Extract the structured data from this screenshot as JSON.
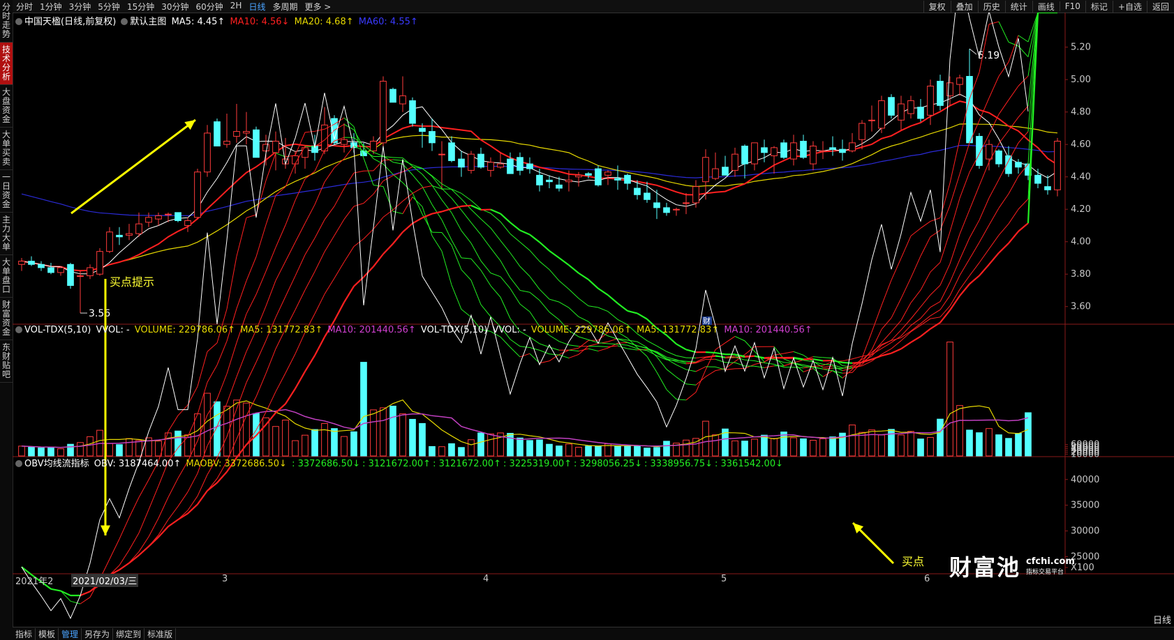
{
  "left_rail": [
    "分时走势",
    "技术分析",
    "大盘资金",
    "大单买卖",
    "一日资金",
    "主力大单",
    "大单盘口",
    "财富资金",
    "东财贴吧"
  ],
  "left_rail_active": 1,
  "topbar": {
    "periods": [
      "分时",
      "1分钟",
      "3分钟",
      "5分钟",
      "15分钟",
      "30分钟",
      "60分钟",
      "2H",
      "日线",
      "多周期",
      "更多 >"
    ],
    "active_period": 8,
    "tools": [
      "复权",
      "叠加",
      "历史",
      "统计",
      "画线",
      "F10",
      "标记",
      "+自选",
      "返回"
    ]
  },
  "main_legend": {
    "title": "中国天楹(日线,前复权)",
    "indicator": "默认主图",
    "ma5": "MA5: 4.45↑",
    "ma10": "MA10: 4.56↓",
    "ma20": "MA20: 4.68↑",
    "ma60": "MA60: 4.55↑"
  },
  "vol_legend": {
    "name": "VOL-TDX(5,10)",
    "vvol": "VVOL: -",
    "volume": "VOLUME: 229786.06↑",
    "ma5": "MA5: 131772.83↑",
    "ma10": "MA10: 201440.56↑",
    "name2": "VOL-TDX(5,10)",
    "vvol2": "VVOL: -",
    "volume2": "VOLUME: 229786.06↑",
    "ma5_2": "MA5: 131772.83↑",
    "ma10_2": "MA10: 201440.56↑"
  },
  "obv_legend": {
    "name": "OBV均线流指标",
    "obv": "OBV: 3187464.00↑",
    "maobv": "MAOBV: 3372686.50↓",
    "values": [
      ": 3372686.50↓",
      ": 3121672.00↑",
      ": 3121672.00↑",
      ": 3225319.00↑",
      ": 3298056.25↓",
      ": 3338956.75↓",
      ": 3361542.00↓"
    ]
  },
  "price_axis": [
    "5.20",
    "5.00",
    "4.80",
    "4.60",
    "4.40",
    "4.20",
    "4.00",
    "3.80",
    "3.60"
  ],
  "volume_axis": [
    "60000",
    "50000",
    "40000",
    "30000",
    "20000",
    "10000",
    "X10"
  ],
  "obv_axis": [
    "40000",
    "35000",
    "30000",
    "25000",
    "X100"
  ],
  "x_axis": {
    "start": "2021年2",
    "cursor_date": "2021/02/03/三",
    "months": [
      "3",
      "4",
      "5",
      "6"
    ],
    "mode": "日线"
  },
  "annotations": {
    "high": "5.19",
    "low": "3.56",
    "buy_hint": "买点提示",
    "buy_point": "买点",
    "news_marker": "财"
  },
  "bottom_tabs": [
    "指标",
    "模板",
    "管理",
    "另存为",
    "绑定到",
    "标准版"
  ],
  "bottom_active": 2,
  "logo": {
    "main": "财富池",
    "domain": "cfchi.com",
    "tagline": "指标交易平台"
  },
  "colors": {
    "up": "#ff3b3b",
    "down": "#54ffff",
    "ma5": "#ffffff",
    "ma10": "#ff2020",
    "ma20": "#e6d800",
    "ma60": "#2b2bd8",
    "vol_ma5": "#e6d800",
    "vol_ma10": "#c040c0",
    "arrow": "#ffff00",
    "obv_up": "#ff2020",
    "obv_down": "#22ee22"
  },
  "chart_data": {
    "type": "candlestick",
    "ohlc": [
      [
        3.86,
        3.9,
        3.82,
        3.88
      ],
      [
        3.88,
        3.91,
        3.85,
        3.86
      ],
      [
        3.86,
        3.88,
        3.82,
        3.84
      ],
      [
        3.84,
        3.87,
        3.8,
        3.81
      ],
      [
        3.81,
        3.85,
        3.79,
        3.84
      ],
      [
        3.86,
        3.87,
        3.71,
        3.73
      ],
      [
        3.79,
        3.82,
        3.56,
        3.79
      ],
      [
        3.79,
        3.86,
        3.77,
        3.84
      ],
      [
        3.8,
        3.96,
        3.79,
        3.94
      ],
      [
        3.94,
        4.09,
        3.93,
        4.06
      ],
      [
        4.04,
        4.09,
        3.98,
        4.03
      ],
      [
        4.04,
        4.11,
        4.01,
        4.05
      ],
      [
        4.05,
        4.18,
        4.03,
        4.11
      ],
      [
        4.12,
        4.18,
        4.09,
        4.15
      ],
      [
        4.14,
        4.18,
        4.1,
        4.16
      ],
      [
        4.17,
        4.18,
        4.12,
        4.17
      ],
      [
        4.18,
        4.18,
        4.12,
        4.13
      ],
      [
        4.1,
        4.15,
        4.06,
        4.13
      ],
      [
        4.15,
        4.45,
        4.14,
        4.43
      ],
      [
        4.43,
        4.72,
        4.4,
        4.67
      ],
      [
        4.74,
        4.76,
        4.59,
        4.59
      ],
      [
        4.6,
        4.79,
        4.58,
        4.62
      ],
      [
        4.65,
        4.85,
        4.61,
        4.68
      ],
      [
        4.67,
        4.8,
        4.6,
        4.68
      ],
      [
        4.69,
        4.71,
        4.52,
        4.52
      ],
      [
        4.56,
        4.66,
        4.47,
        4.6
      ],
      [
        4.55,
        4.68,
        4.44,
        4.62
      ],
      [
        4.48,
        4.64,
        4.45,
        4.51
      ],
      [
        4.48,
        4.56,
        4.42,
        4.53
      ],
      [
        4.52,
        4.59,
        4.45,
        4.58
      ],
      [
        4.59,
        4.66,
        4.5,
        4.55
      ],
      [
        4.56,
        4.83,
        4.54,
        4.72
      ],
      [
        4.76,
        4.78,
        4.6,
        4.61
      ],
      [
        4.6,
        4.73,
        4.55,
        4.63
      ],
      [
        4.61,
        4.67,
        4.55,
        4.58
      ],
      [
        4.56,
        4.61,
        4.53,
        4.53
      ],
      [
        4.56,
        4.65,
        4.54,
        4.62
      ],
      [
        4.61,
        5.02,
        4.57,
        4.99
      ],
      [
        4.94,
        4.95,
        4.86,
        4.86
      ],
      [
        4.85,
        5.02,
        4.8,
        4.9
      ],
      [
        4.87,
        4.89,
        4.71,
        4.73
      ],
      [
        4.7,
        4.73,
        4.58,
        4.68
      ],
      [
        4.68,
        4.76,
        4.56,
        4.61
      ],
      [
        4.54,
        4.62,
        4.32,
        4.54
      ],
      [
        4.61,
        4.65,
        4.49,
        4.5
      ],
      [
        4.51,
        4.56,
        4.4,
        4.46
      ],
      [
        4.44,
        4.56,
        4.42,
        4.54
      ],
      [
        4.54,
        4.58,
        4.45,
        4.46
      ],
      [
        4.44,
        4.52,
        4.4,
        4.49
      ],
      [
        4.46,
        4.55,
        4.45,
        4.48
      ],
      [
        4.51,
        4.55,
        4.42,
        4.42
      ],
      [
        4.52,
        4.55,
        4.41,
        4.44
      ],
      [
        4.48,
        4.52,
        4.42,
        4.45
      ],
      [
        4.41,
        4.45,
        4.31,
        4.35
      ],
      [
        4.38,
        4.41,
        4.33,
        4.37
      ],
      [
        4.35,
        4.4,
        4.31,
        4.33
      ],
      [
        4.37,
        4.44,
        4.31,
        4.38
      ],
      [
        4.4,
        4.43,
        4.34,
        4.41
      ],
      [
        4.42,
        4.43,
        4.39,
        4.41
      ],
      [
        4.45,
        4.47,
        4.34,
        4.35
      ],
      [
        4.41,
        4.44,
        4.35,
        4.43
      ],
      [
        4.39,
        4.47,
        4.32,
        4.38
      ],
      [
        4.41,
        4.42,
        4.32,
        4.36
      ],
      [
        4.33,
        4.38,
        4.26,
        4.29
      ],
      [
        4.3,
        4.37,
        4.24,
        4.26
      ],
      [
        4.24,
        4.32,
        4.14,
        4.21
      ],
      [
        4.21,
        4.24,
        4.16,
        4.18
      ],
      [
        4.2,
        4.21,
        4.16,
        4.2
      ],
      [
        4.24,
        4.3,
        4.17,
        4.24
      ],
      [
        4.24,
        4.38,
        4.21,
        4.34
      ],
      [
        4.37,
        4.57,
        4.26,
        4.52
      ],
      [
        4.39,
        4.55,
        4.38,
        4.45
      ],
      [
        4.46,
        4.53,
        4.41,
        4.41
      ],
      [
        4.44,
        4.58,
        4.4,
        4.54
      ],
      [
        4.59,
        4.6,
        4.39,
        4.48
      ],
      [
        4.48,
        4.61,
        4.44,
        4.61
      ],
      [
        4.58,
        4.63,
        4.49,
        4.55
      ],
      [
        4.53,
        4.59,
        4.42,
        4.58
      ],
      [
        4.61,
        4.63,
        4.51,
        4.52
      ],
      [
        4.51,
        4.66,
        4.47,
        4.61
      ],
      [
        4.62,
        4.66,
        4.51,
        4.52
      ],
      [
        4.48,
        4.62,
        4.44,
        4.59
      ],
      [
        4.56,
        4.62,
        4.51,
        4.56
      ],
      [
        4.58,
        4.65,
        4.53,
        4.57
      ],
      [
        4.57,
        4.63,
        4.5,
        4.55
      ],
      [
        4.56,
        4.67,
        4.55,
        4.61
      ],
      [
        4.63,
        4.75,
        4.57,
        4.73
      ],
      [
        4.75,
        4.84,
        4.68,
        4.75
      ],
      [
        4.7,
        4.9,
        4.67,
        4.87
      ],
      [
        4.89,
        4.91,
        4.76,
        4.78
      ],
      [
        4.75,
        4.9,
        4.69,
        4.85
      ],
      [
        4.79,
        4.9,
        4.76,
        4.87
      ],
      [
        4.83,
        4.88,
        4.74,
        4.76
      ],
      [
        4.78,
        5.0,
        4.72,
        4.96
      ],
      [
        4.99,
        5.03,
        4.81,
        4.84
      ],
      [
        4.9,
        5.02,
        4.84,
        4.98
      ],
      [
        4.97,
        5.03,
        4.9,
        5.01
      ],
      [
        5.02,
        5.19,
        4.8,
        4.61
      ],
      [
        4.65,
        4.67,
        4.45,
        4.47
      ],
      [
        4.51,
        4.63,
        4.44,
        4.6
      ],
      [
        4.56,
        4.57,
        4.46,
        4.48
      ],
      [
        4.53,
        4.59,
        4.4,
        4.42
      ],
      [
        4.49,
        4.51,
        4.42,
        4.46
      ],
      [
        4.48,
        4.49,
        4.38,
        4.41
      ],
      [
        4.41,
        4.45,
        4.33,
        4.36
      ],
      [
        4.34,
        4.41,
        4.29,
        4.32
      ],
      [
        4.32,
        4.64,
        4.28,
        4.62
      ]
    ],
    "volume": [
      5200,
      4800,
      4300,
      4600,
      3800,
      6200,
      7100,
      10200,
      13600,
      6600,
      6000,
      9200,
      8200,
      9600,
      7900,
      12200,
      13200,
      11200,
      22300,
      33200,
      28700,
      26300,
      29600,
      28000,
      22500,
      20200,
      15600,
      19000,
      8100,
      11000,
      14000,
      17200,
      14500,
      10300,
      12800,
      49600,
      24400,
      25500,
      26400,
      22300,
      19400,
      17200,
      5000,
      4900,
      6500,
      4500,
      8600,
      12200,
      11700,
      12200,
      12000,
      9500,
      8200,
      8500,
      6200,
      5300,
      6300,
      4600,
      5200,
      5100,
      6400,
      5400,
      5300,
      5400,
      4200,
      4500,
      7800,
      6800,
      8400,
      9300,
      18400,
      11200,
      14300,
      8000,
      7900,
      8900,
      11000,
      9300,
      12700,
      9600,
      9100,
      8300,
      9100,
      10100,
      12100,
      16400,
      12500,
      13800,
      11100,
      14100,
      11100,
      13000,
      9000,
      9800,
      19500,
      60300,
      26700,
      13700,
      12300,
      14500,
      11200,
      9300,
      12000,
      22900
    ],
    "ylim_price": [
      3.5,
      5.25
    ],
    "ylim_volume": [
      0,
      62000
    ],
    "ylim_obv": [
      21000,
      42000
    ]
  }
}
